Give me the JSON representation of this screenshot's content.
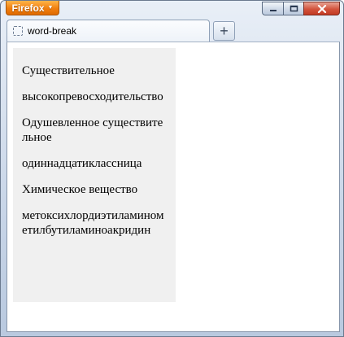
{
  "window": {
    "app_button_label": "Firefox",
    "app_button_caret": "▼"
  },
  "tab": {
    "title": "word-break",
    "new_tab_label": "+"
  },
  "content": {
    "words": [
      "Существительное",
      "высокопревосходительство",
      "Одушевленное существительное",
      "одиннадцатиклассница",
      "Химическое вещество",
      "метоксихлордиэтиламинометилбутиламиноакридин"
    ]
  },
  "colors": {
    "app_button": "#f07f0f",
    "close_button": "#d2533c",
    "panel_background": "#f0f0f0",
    "frame": "#c9d6e8"
  },
  "icons": {
    "tab": "page-icon",
    "minimize": "minimize-icon",
    "maximize": "maximize-icon",
    "close": "close-icon"
  }
}
